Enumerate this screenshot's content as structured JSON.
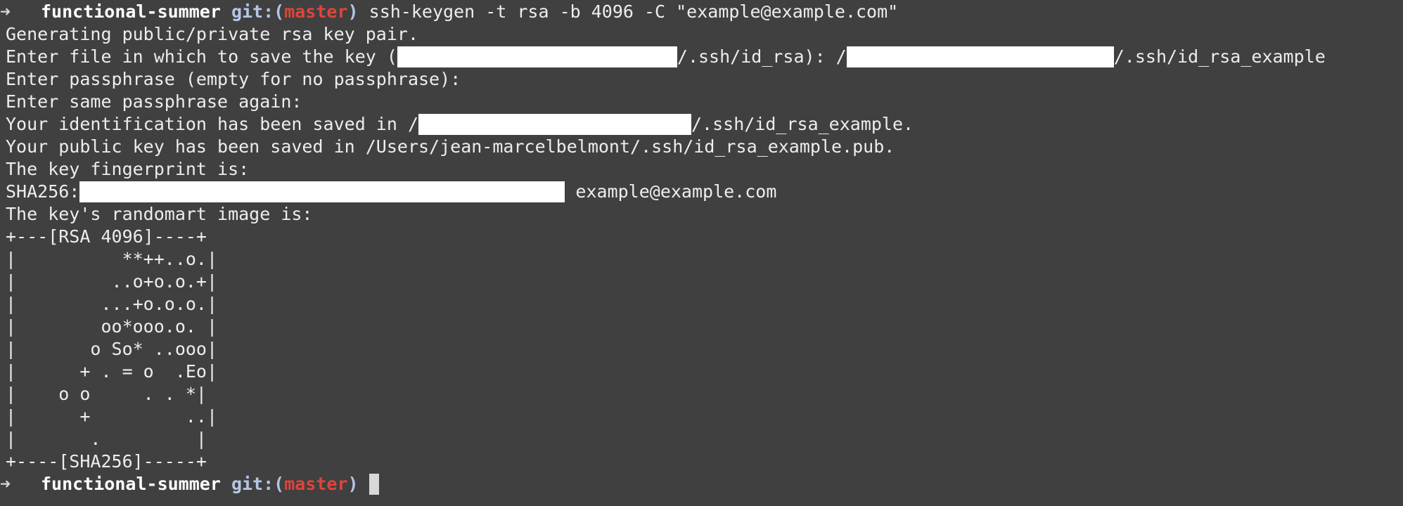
{
  "prompt": {
    "arrow": "➜",
    "directory": "functional-summer",
    "git_prefix": "git:(",
    "branch": "master",
    "git_suffix": ")"
  },
  "command": "ssh-keygen -t rsa -b 4096 -C \"example@example.com\"",
  "output": {
    "line1": "Generating public/private rsa key pair.",
    "line2_a": "Enter file in which to save the key (",
    "line2_b": "/.ssh/id_rsa): /",
    "line2_c": "/.ssh/id_rsa_example",
    "line3": "Enter passphrase (empty for no passphrase):",
    "line4": "Enter same passphrase again:",
    "line5_a": "Your identification has been saved in /",
    "line5_b": "/.ssh/id_rsa_example.",
    "line6": "Your public key has been saved in /Users/jean-marcelbelmont/.ssh/id_rsa_example.pub.",
    "line7": "The key fingerprint is:",
    "line8_a": "SHA256:",
    "line8_b": " example@example.com",
    "line9": "The key's randomart image is:"
  },
  "randomart": [
    "+---[RSA 4096]----+",
    "|          **++..o.|",
    "|         ..o+o.o.+|",
    "|        ...+o.o.o.|",
    "|        oo*ooo.o. |",
    "|       o So* ..ooo|",
    "|      + . = o  .Eo|",
    "|    o o     . . *|",
    "|      +         ..|",
    "|       .         |",
    "+----[SHA256]-----+"
  ]
}
